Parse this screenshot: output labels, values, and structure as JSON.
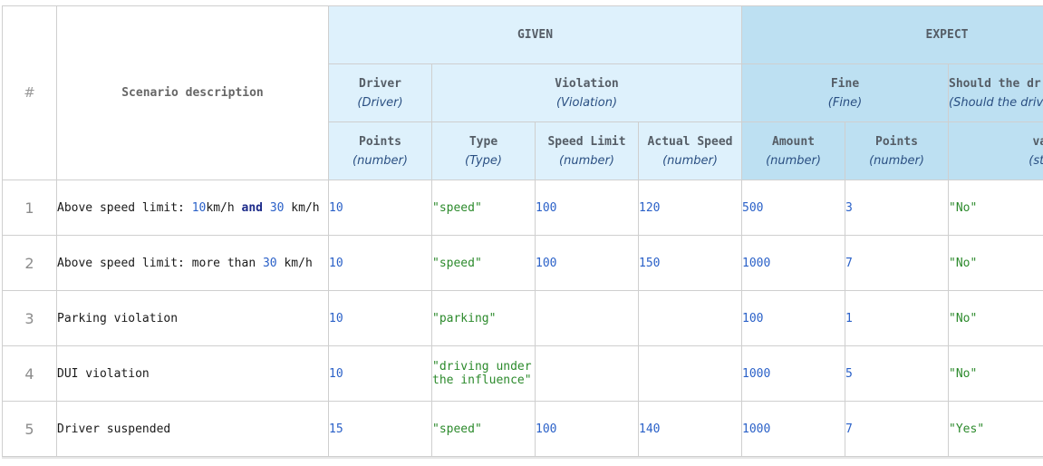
{
  "headers": {
    "index": "#",
    "description": "Scenario description",
    "given": "GIVEN",
    "expect": "EXPECT",
    "groups": [
      {
        "name": "Driver",
        "type": "(Driver)"
      },
      {
        "name": "Violation",
        "type": "(Violation)"
      },
      {
        "name": "Fine",
        "type": "(Fine)"
      },
      {
        "name": "Should the dr",
        "type": "(Should the driv..."
      }
    ],
    "fields": [
      {
        "name": "Points",
        "type": "(number)"
      },
      {
        "name": "Type",
        "type": "(Type)"
      },
      {
        "name": "Speed Limit",
        "type": "(number)"
      },
      {
        "name": "Actual Speed",
        "type": "(number)"
      },
      {
        "name": "Amount",
        "type": "(number)"
      },
      {
        "name": "Points",
        "type": "(number)"
      },
      {
        "name": "value",
        "type": "(string)"
      }
    ]
  },
  "rows": [
    {
      "index": "1",
      "description": {
        "pre": "Above speed limit: ",
        "n1": "10",
        "mid1": "km/h ",
        "and": "and",
        "mid2": " ",
        "n2": "30",
        "post": " km/h"
      },
      "driver_points": "10",
      "type": "\"speed\"",
      "speed_limit": "100",
      "actual_speed": "120",
      "amount": "500",
      "fine_points": "3",
      "suspended": "\"No\""
    },
    {
      "index": "2",
      "description": {
        "pre": "Above speed limit: more than ",
        "n1": "30",
        "post": " km/h"
      },
      "driver_points": "10",
      "type": "\"speed\"",
      "speed_limit": "100",
      "actual_speed": "150",
      "amount": "1000",
      "fine_points": "7",
      "suspended": "\"No\""
    },
    {
      "index": "3",
      "description": {
        "text": "Parking violation"
      },
      "driver_points": "10",
      "type": "\"parking\"",
      "speed_limit": "",
      "actual_speed": "",
      "amount": "100",
      "fine_points": "1",
      "suspended": "\"No\""
    },
    {
      "index": "4",
      "description": {
        "text": "DUI violation"
      },
      "driver_points": "10",
      "type": "\"driving under the influence\"",
      "speed_limit": "",
      "actual_speed": "",
      "amount": "1000",
      "fine_points": "5",
      "suspended": "\"No\""
    },
    {
      "index": "5",
      "description": {
        "text": "Driver suspended"
      },
      "driver_points": "15",
      "type": "\"speed\"",
      "speed_limit": "100",
      "actual_speed": "140",
      "amount": "1000",
      "fine_points": "7",
      "suspended": "\"Yes\""
    }
  ]
}
